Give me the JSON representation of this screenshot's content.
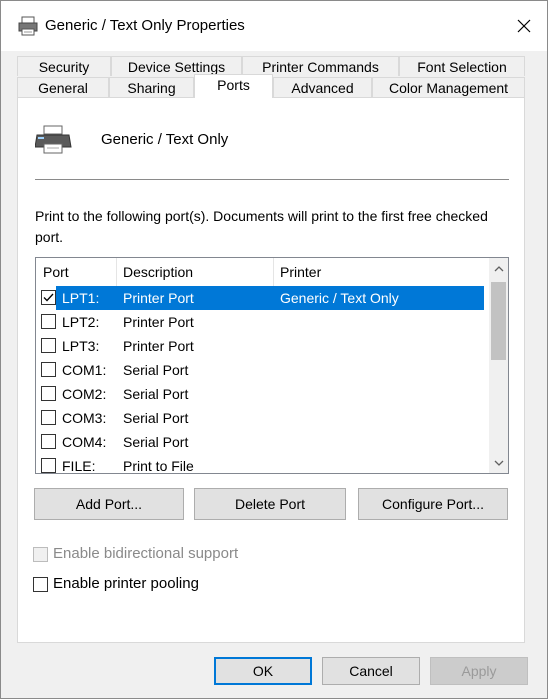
{
  "window": {
    "title": "Generic / Text Only Properties"
  },
  "tabs_back": [
    {
      "label": "Security"
    },
    {
      "label": "Device Settings"
    },
    {
      "label": "Printer Commands"
    },
    {
      "label": "Font Selection"
    }
  ],
  "tabs_front": [
    {
      "label": "General"
    },
    {
      "label": "Sharing"
    },
    {
      "label": "Ports",
      "active": true
    },
    {
      "label": "Advanced"
    },
    {
      "label": "Color Management"
    }
  ],
  "printer": {
    "name": "Generic / Text Only"
  },
  "info_text": "Print to the following port(s). Documents will print to the first free checked port.",
  "port_list": {
    "columns": [
      "Port",
      "Description",
      "Printer"
    ],
    "rows": [
      {
        "port": "LPT1:",
        "description": "Printer Port",
        "printer": "Generic / Text Only",
        "checked": true,
        "selected": true
      },
      {
        "port": "LPT2:",
        "description": "Printer Port",
        "printer": "",
        "checked": false
      },
      {
        "port": "LPT3:",
        "description": "Printer Port",
        "printer": "",
        "checked": false
      },
      {
        "port": "COM1:",
        "description": "Serial Port",
        "printer": "",
        "checked": false
      },
      {
        "port": "COM2:",
        "description": "Serial Port",
        "printer": "",
        "checked": false
      },
      {
        "port": "COM3:",
        "description": "Serial Port",
        "printer": "",
        "checked": false
      },
      {
        "port": "COM4:",
        "description": "Serial Port",
        "printer": "",
        "checked": false
      },
      {
        "port": "FILE:",
        "description": "Print to File",
        "printer": "",
        "checked": false
      }
    ]
  },
  "port_buttons": {
    "add": "Add Port...",
    "delete": "Delete Port",
    "configure": "Configure Port..."
  },
  "options": {
    "bidirectional": {
      "label": "Enable bidirectional support",
      "enabled": false,
      "checked": false
    },
    "pooling": {
      "label": "Enable printer pooling",
      "enabled": true,
      "checked": false
    }
  },
  "footer": {
    "ok": "OK",
    "cancel": "Cancel",
    "apply": "Apply"
  },
  "colors": {
    "selection": "#0078d7",
    "panel": "#ffffff",
    "chrome": "#f0f0f0"
  }
}
